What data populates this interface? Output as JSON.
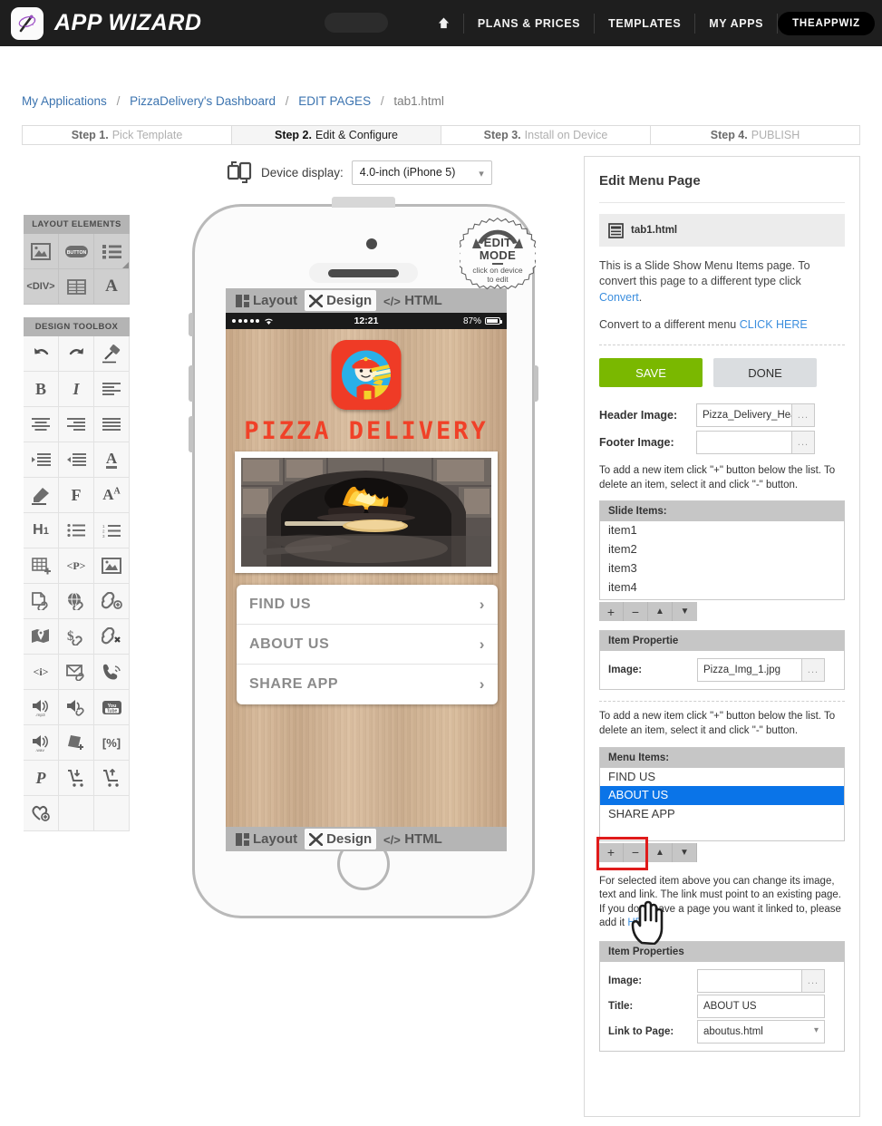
{
  "topnav": {
    "brand": "APP WIZARD",
    "logo_icon": "magic-wand-icon",
    "home_icon": "home-icon",
    "items": [
      {
        "label": "PLANS & PRICES"
      },
      {
        "label": "TEMPLATES"
      },
      {
        "label": "MY APPS"
      }
    ],
    "user": "THEAPPWIZ"
  },
  "breadcrumb": {
    "items": [
      "My Applications",
      "PizzaDelivery's Dashboard",
      "EDIT PAGES"
    ],
    "current": "tab1.html",
    "separator": "/"
  },
  "steps": [
    {
      "num": "Step 1.",
      "label": "Pick Template",
      "active": false
    },
    {
      "num": "Step 2.",
      "label": "Edit & Configure",
      "active": true
    },
    {
      "num": "Step 3.",
      "label": "Install on Device",
      "active": false
    },
    {
      "num": "Step 4.",
      "label": "PUBLISH",
      "active": false
    }
  ],
  "device": {
    "icon": "device-rotate-icon",
    "label": "Device display:",
    "selected": "4.0-inch (iPhone 5)",
    "chevron": "chevron-down-icon"
  },
  "layout_elements": {
    "title": "LAYOUT ELEMENTS",
    "cells": [
      {
        "icon": "image-frame-icon"
      },
      {
        "icon": "button-icon"
      },
      {
        "icon": "list-icon"
      },
      {
        "icon": "div-tag-icon"
      },
      {
        "icon": "table-icon"
      },
      {
        "icon": "text-letter-icon"
      }
    ]
  },
  "design_toolbox": {
    "title": "DESIGN TOOLBOX",
    "cells": [
      {
        "icon": "undo-icon"
      },
      {
        "icon": "redo-icon"
      },
      {
        "icon": "eraser-icon"
      },
      {
        "icon": "bold-icon"
      },
      {
        "icon": "italic-icon"
      },
      {
        "icon": "align-left-icon"
      },
      {
        "icon": "align-center-icon"
      },
      {
        "icon": "align-right-icon"
      },
      {
        "icon": "align-justify-icon"
      },
      {
        "icon": "indent-increase-icon"
      },
      {
        "icon": "indent-decrease-icon"
      },
      {
        "icon": "font-color-icon"
      },
      {
        "icon": "highlighter-icon"
      },
      {
        "icon": "font-family-icon"
      },
      {
        "icon": "font-size-icon"
      },
      {
        "icon": "heading-h1-icon"
      },
      {
        "icon": "bullet-list-icon"
      },
      {
        "icon": "numbered-list-icon"
      },
      {
        "icon": "insert-table-icon"
      },
      {
        "icon": "paragraph-tag-icon"
      },
      {
        "icon": "insert-image-icon"
      },
      {
        "icon": "page-link-icon"
      },
      {
        "icon": "web-link-icon"
      },
      {
        "icon": "add-link-icon"
      },
      {
        "icon": "map-link-icon"
      },
      {
        "icon": "payment-link-icon"
      },
      {
        "icon": "remove-link-icon"
      },
      {
        "icon": "info-tag-icon"
      },
      {
        "icon": "email-link-icon"
      },
      {
        "icon": "phone-link-icon"
      },
      {
        "icon": "audio-mp3-icon"
      },
      {
        "icon": "audio-link-icon"
      },
      {
        "icon": "youtube-icon"
      },
      {
        "icon": "audio-wav-icon"
      },
      {
        "icon": "add-file-icon"
      },
      {
        "icon": "percent-icon"
      },
      {
        "icon": "paypal-icon"
      },
      {
        "icon": "cart-add-icon"
      },
      {
        "icon": "cart-upload-icon"
      },
      {
        "icon": "favorite-add-icon"
      }
    ]
  },
  "phone": {
    "edit_badge": {
      "line1": "EDIT",
      "line2": "MODE",
      "sub1": "click on device",
      "sub2": "to edit"
    },
    "top_toolbar": [
      {
        "label": "Layout",
        "icon": "layout-icon",
        "selected": false
      },
      {
        "label": "Design",
        "icon": "design-icon",
        "selected": true
      },
      {
        "label": "HTML",
        "icon": "html-code-icon",
        "selected": false
      }
    ],
    "bottom_toolbar": [
      {
        "label": "Layout",
        "icon": "layout-icon",
        "selected": false
      },
      {
        "label": "Design",
        "icon": "design-icon",
        "selected": true
      },
      {
        "label": "HTML",
        "icon": "html-code-icon",
        "selected": false
      }
    ],
    "status_bar": {
      "signal": "signal-dots-icon",
      "wifi": "wifi-icon",
      "time": "12:21",
      "battery_pct": "87%",
      "battery_icon": "battery-icon"
    },
    "app": {
      "icon": "pizza-delivery-man-icon",
      "title": "PIZZA DELIVERY",
      "photo": "pizza-oven-photo",
      "menu": [
        {
          "label": "FIND US",
          "arrow": "chevron-right-icon"
        },
        {
          "label": "ABOUT US",
          "arrow": "chevron-right-icon"
        },
        {
          "label": "SHARE APP",
          "arrow": "chevron-right-icon"
        }
      ]
    }
  },
  "right_panel": {
    "title": "Edit Menu Page",
    "file_icon": "page-file-icon",
    "file_name": "tab1.html",
    "desc_1a": "This is a Slide Show Menu Items page. To convert this page to a different type click ",
    "desc_1_link": "Convert",
    "desc_1b": ".",
    "desc_2a": "Convert to a different menu ",
    "desc_2_link": "CLICK HERE",
    "save_label": "SAVE",
    "done_label": "DONE",
    "save_color": "#7ab800",
    "header_image_label": "Header Image:",
    "header_image_value": "Pizza_Delivery_Hea",
    "footer_image_label": "Footer Image:",
    "footer_image_value": "",
    "dots_button": "...",
    "hint_slide": "To add a new item click \"+\" button below the list. To delete an item, select it and click \"-\" button.",
    "slide_items_title": "Slide Items:",
    "slide_items": [
      "item1",
      "item2",
      "item3",
      "item4"
    ],
    "slide_controls": [
      {
        "icon": "plus-icon",
        "glyph": "+"
      },
      {
        "icon": "minus-icon",
        "glyph": "−"
      },
      {
        "icon": "move-up-icon",
        "glyph": "▲"
      },
      {
        "icon": "move-down-icon",
        "glyph": "▼"
      }
    ],
    "item_props_title_1": "Item Propertie",
    "item_image_label": "Image:",
    "item_image_value": "Pizza_Img_1.jpg",
    "hint_menu": "To add a new item click \"+\" button below the list. To delete an item, select it and click \"-\" button.",
    "menu_items_title": "Menu Items:",
    "menu_items": [
      {
        "label": "FIND US",
        "selected": false
      },
      {
        "label": "ABOUT US",
        "selected": true
      },
      {
        "label": "SHARE APP",
        "selected": false
      }
    ],
    "menu_controls": [
      {
        "icon": "plus-icon",
        "glyph": "+"
      },
      {
        "icon": "minus-icon",
        "glyph": "−"
      },
      {
        "icon": "move-up-icon",
        "glyph": "▲"
      },
      {
        "icon": "move-down-icon",
        "glyph": "▼"
      }
    ],
    "highlight_color": "#e01b1b",
    "hint_selected_a": "For selected item above you can change its image, text and link. The link must point to an existing page. If you don't have a page you want it linked to, please add it ",
    "hint_selected_link": "HERE",
    "item_props_title_2": "Item Properties",
    "props": {
      "image_label": "Image:",
      "image_value": "",
      "title_label": "Title:",
      "title_value": "ABOUT US",
      "link_label": "Link to Page:",
      "link_value": "aboutus.html"
    }
  }
}
